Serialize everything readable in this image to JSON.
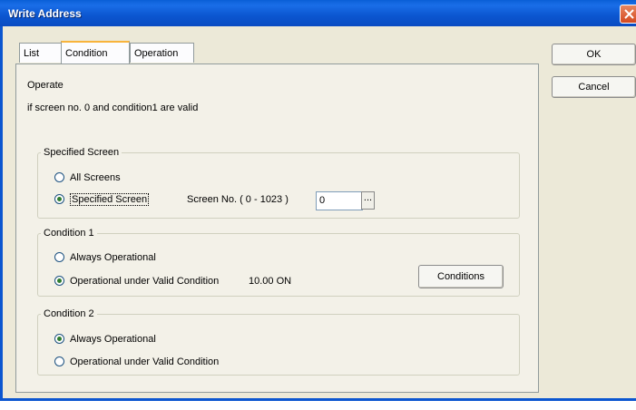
{
  "window": {
    "title": "Write Address"
  },
  "tabs": [
    {
      "label": "List",
      "active": false
    },
    {
      "label": "Condition",
      "active": true
    },
    {
      "label": "Operation",
      "active": false
    }
  ],
  "summary": {
    "heading": "Operate",
    "description": "if screen no. 0 and condition1 are valid"
  },
  "specified_screen": {
    "legend": "Specified Screen",
    "option_all": "All Screens",
    "option_specified": "Specified Screen",
    "selected": "specified",
    "screen_no_label": "Screen No. ( 0 - 1023 )",
    "screen_no_value": "0",
    "browse_label": "..."
  },
  "condition1": {
    "legend": "Condition 1",
    "option_always": "Always Operational",
    "option_valid": "Operational under Valid Condition",
    "selected": "valid",
    "condition_value": "10.00 ON",
    "conditions_button": "Conditions"
  },
  "condition2": {
    "legend": "Condition 2",
    "option_always": "Always Operational",
    "option_valid": "Operational under Valid Condition",
    "selected": "always"
  },
  "buttons": {
    "ok": "OK",
    "cancel": "Cancel"
  },
  "colors": {
    "titlebar": "#0b56d0",
    "dialog_bg": "#ece9d8",
    "active_tab_accent": "#f8b43c",
    "close_button": "#d4491f"
  }
}
